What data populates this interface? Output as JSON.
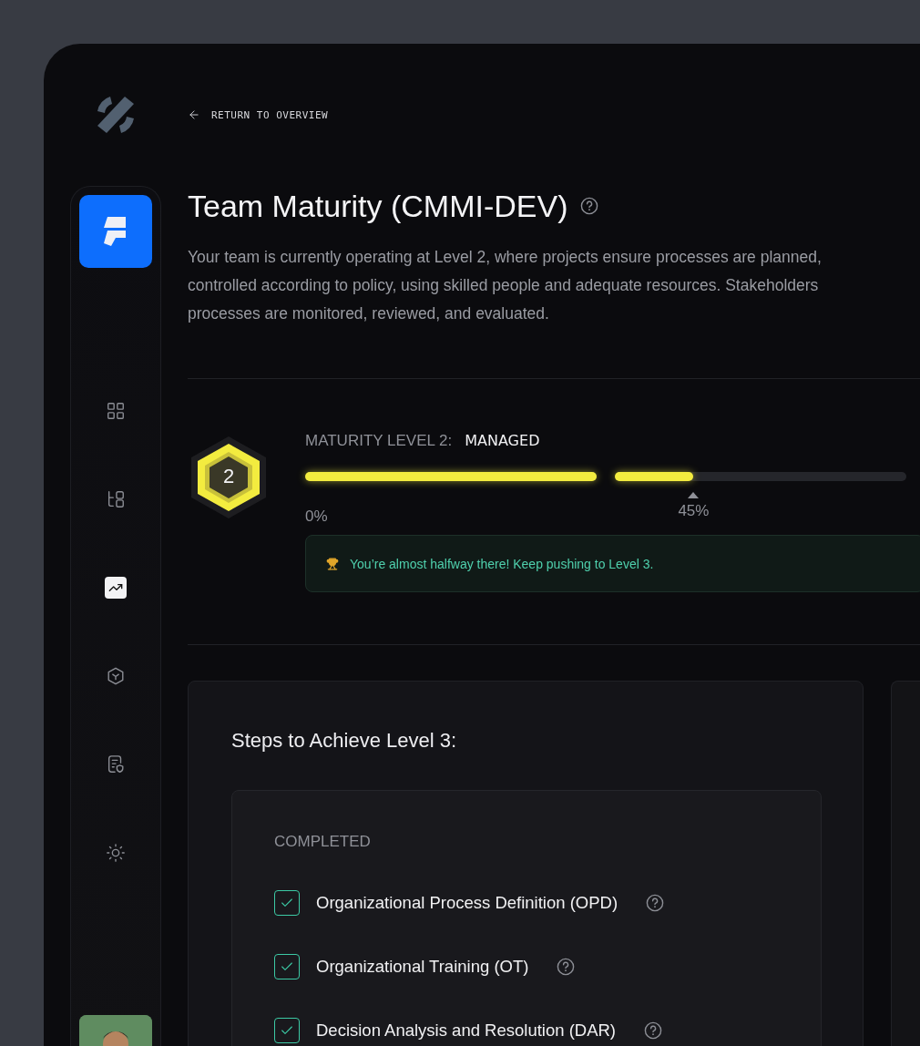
{
  "back_link": {
    "label": "RETURN TO OVERVIEW"
  },
  "nav": [
    {
      "kind": "grid",
      "selected": false
    },
    {
      "kind": "hierarchy",
      "selected": false
    },
    {
      "kind": "chart",
      "selected": true
    },
    {
      "kind": "cube",
      "selected": false
    },
    {
      "kind": "document",
      "selected": false
    },
    {
      "kind": "sun",
      "selected": false
    }
  ],
  "title": "Team Maturity (CMMI-DEV)",
  "description": [
    "Your team is currently operating at Level 2, where projects ensure processes are planned,",
    "controlled according to policy, using skilled people and adequate resources. Stakeholders",
    "processes are monitored, reviewed, and evaluated."
  ],
  "maturity": {
    "badge": "2",
    "label": "MATURITY LEVEL 2:",
    "value": "MANAGED",
    "segments": [
      {
        "level": 1
      },
      {
        "level": 0.27
      }
    ],
    "start_label": "0%",
    "marker_label": "45%",
    "message": "You’re almost halfway there! Keep pushing to Level 3."
  },
  "steps": {
    "title": "Steps to Achieve Level 3:",
    "groups": [
      {
        "heading": "COMPLETED",
        "items": [
          {
            "label": "Organizational Process Definition (OPD)",
            "checked": true
          },
          {
            "label": "Organizational Training (OT)",
            "checked": true
          },
          {
            "label": "Decision Analysis and Resolution (DAR)",
            "checked": true
          }
        ]
      }
    ]
  }
}
